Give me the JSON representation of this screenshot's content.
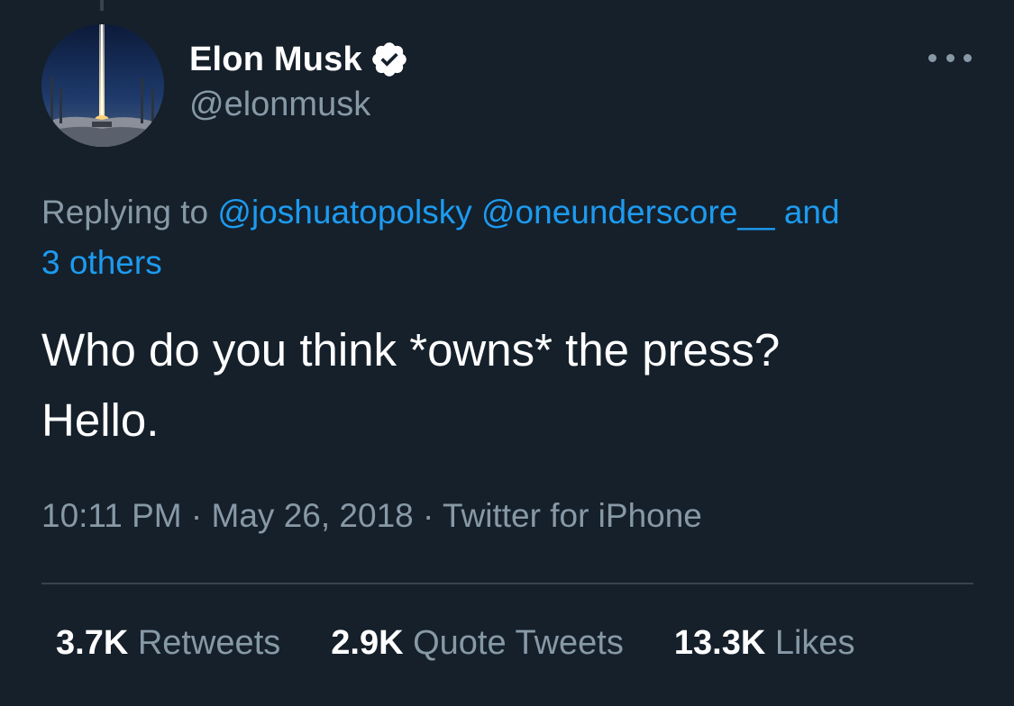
{
  "user": {
    "display_name": "Elon Musk",
    "handle": "@elonmusk",
    "verified": true,
    "avatar_icon": "rocket-launch-avatar"
  },
  "menu_icon": "more-options-icon",
  "reply": {
    "prefix": "Replying to",
    "mentions": [
      "@joshuatopolsky",
      "@oneunderscore__"
    ],
    "joiner": "and",
    "others": "3 others"
  },
  "tweet": {
    "line1": "Who do you think *owns* the press?",
    "line2": "Hello."
  },
  "meta": {
    "time": "10:11 PM",
    "separator": "·",
    "date": "May 26, 2018",
    "source": "Twitter for iPhone"
  },
  "stats": [
    {
      "count": "3.7K",
      "label": "Retweets"
    },
    {
      "count": "2.9K",
      "label": "Quote Tweets"
    },
    {
      "count": "13.3K",
      "label": "Likes"
    }
  ],
  "colors": {
    "background": "#15202b",
    "link": "#1d9bf0",
    "secondary_text": "#8899a6",
    "divider": "#38444d"
  }
}
